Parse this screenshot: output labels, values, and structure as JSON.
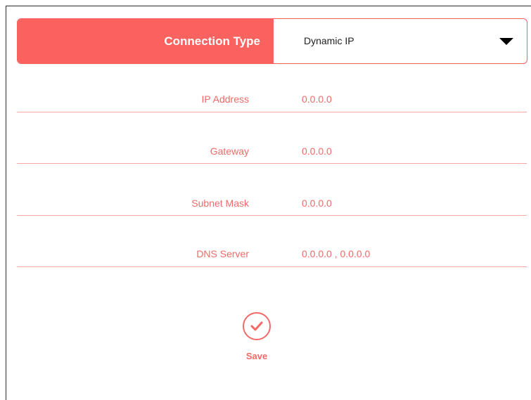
{
  "connection_type": {
    "label": "Connection Type",
    "selected": "Dynamic IP"
  },
  "info": [
    {
      "label": "IP Address",
      "value": "0.0.0.0"
    },
    {
      "label": "Gateway",
      "value": "0.0.0.0"
    },
    {
      "label": "Subnet Mask",
      "value": "0.0.0.0"
    },
    {
      "label": "DNS Server",
      "value": "0.0.0.0 , 0.0.0.0"
    }
  ],
  "save": {
    "label": "Save",
    "icon": "checkmark-circle-icon"
  },
  "colors": {
    "accent": "#fa625f",
    "text_accent": "#f26a67",
    "divider": "#f5a7a5"
  }
}
